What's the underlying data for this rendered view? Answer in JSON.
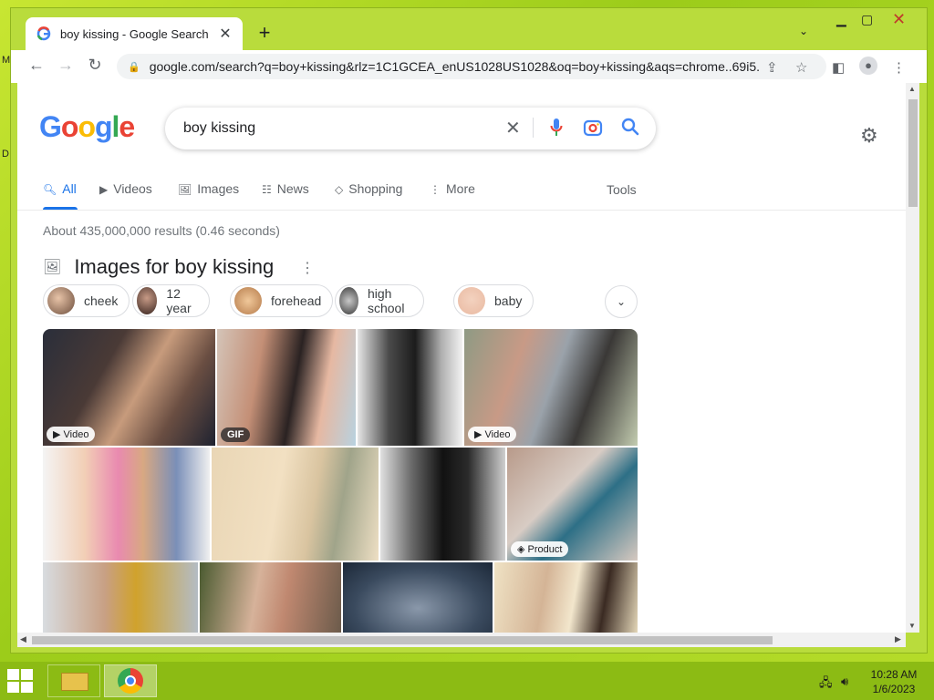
{
  "window": {
    "tab_title": "boy kissing - Google Search",
    "url": "google.com/search?q=boy+kissing&rlz=1C1GCEA_enUS1028US1028&oq=boy+kissing&aqs=chrome..69i5..."
  },
  "search": {
    "logo": [
      "G",
      "o",
      "o",
      "g",
      "l",
      "e"
    ],
    "logo_colors": [
      "#4285F4",
      "#EA4335",
      "#FBBC05",
      "#4285F4",
      "#34A853",
      "#EA4335"
    ],
    "query": "boy kissing"
  },
  "nav": {
    "tabs": [
      {
        "label": "All",
        "icon": "search-icon"
      },
      {
        "label": "Videos",
        "icon": "play-icon"
      },
      {
        "label": "Images",
        "icon": "image-icon"
      },
      {
        "label": "News",
        "icon": "news-icon"
      },
      {
        "label": "Shopping",
        "icon": "tag-icon"
      },
      {
        "label": "More",
        "icon": "kebab-icon"
      }
    ],
    "tools": "Tools"
  },
  "results": {
    "stats": "About 435,000,000 results (0.46 seconds)",
    "images_heading": "Images for boy kissing",
    "chips": [
      "cheek",
      "12 year",
      "forehead",
      "high school",
      "baby"
    ],
    "image_badges": {
      "video1": "Video",
      "gif": "GIF",
      "video2": "Video",
      "product": "Product"
    }
  },
  "taskbar": {
    "time": "10:28 AM",
    "date": "1/6/2023"
  },
  "colors": {
    "accent": "#1a73e8",
    "desktop": "#9ccc1a"
  }
}
